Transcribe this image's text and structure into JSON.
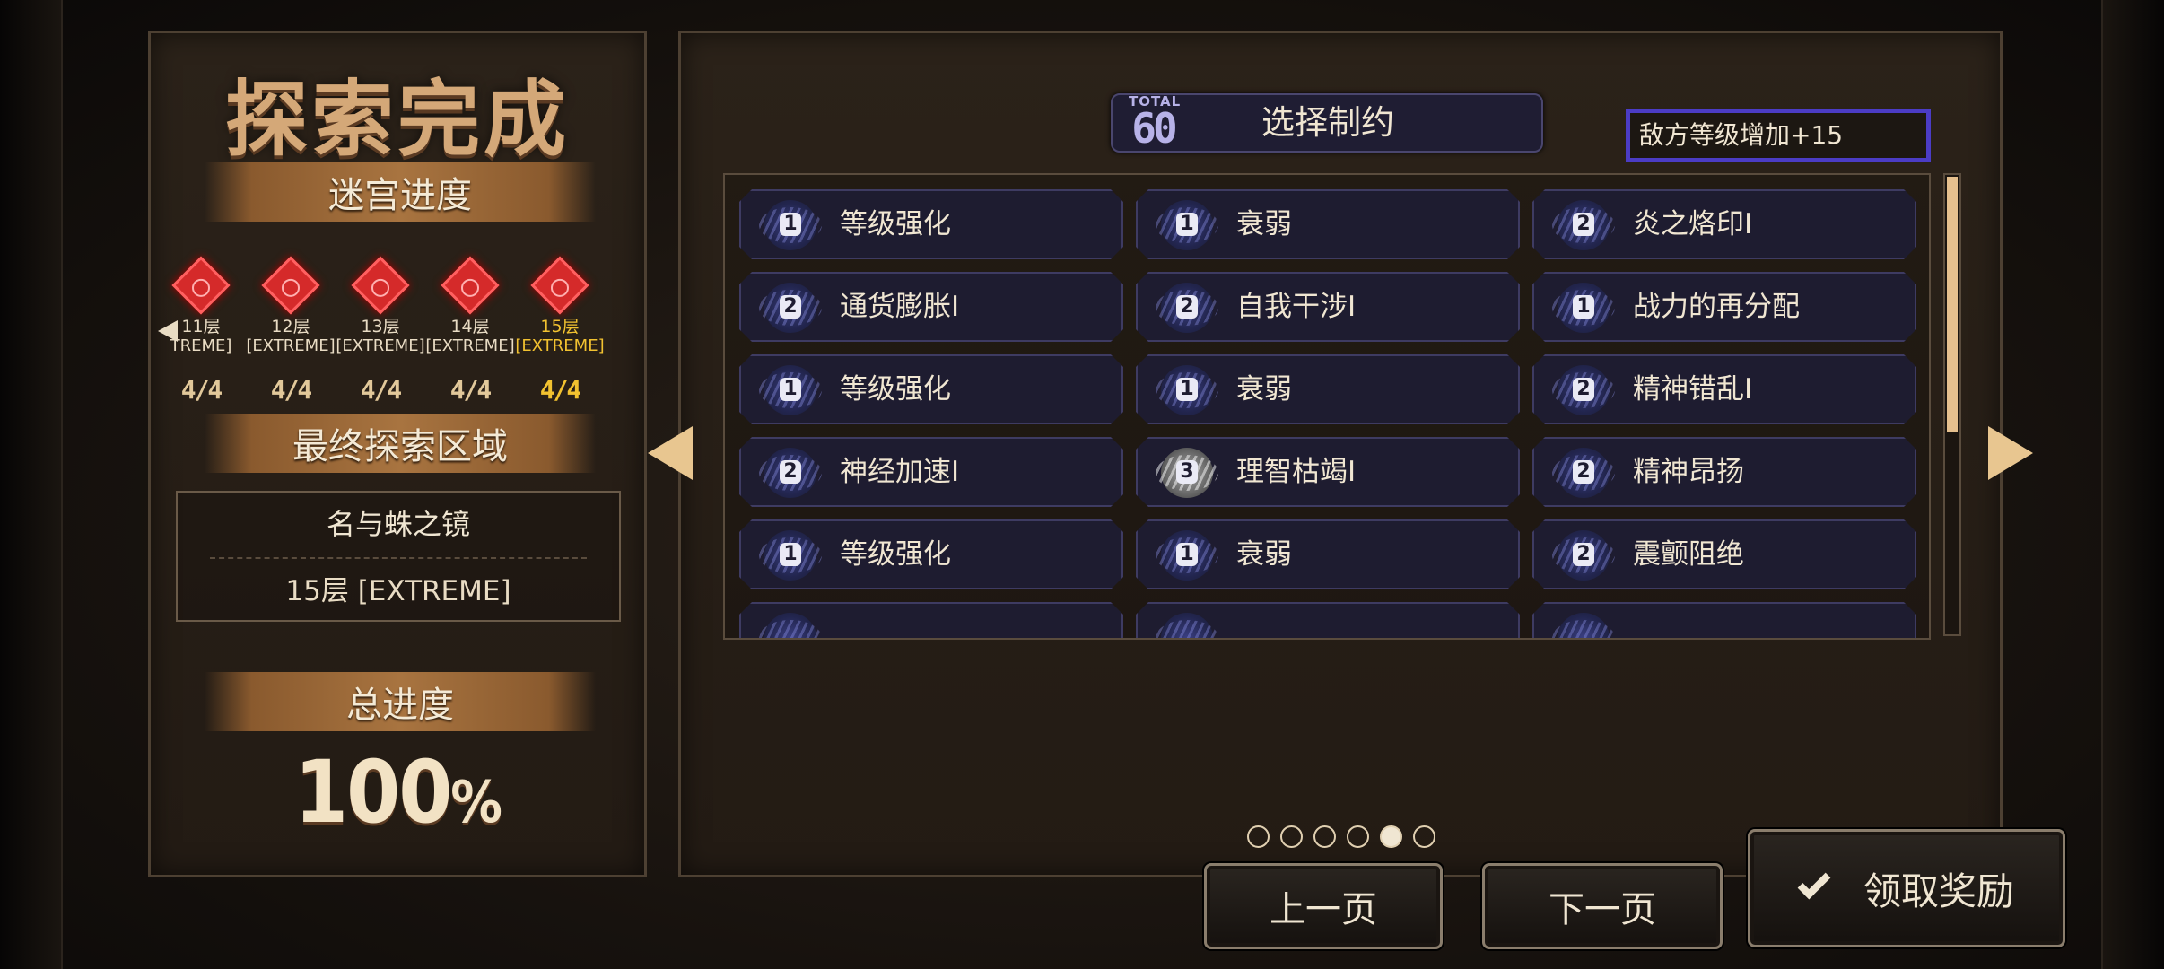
{
  "left_panel": {
    "title": "探索完成",
    "maze_progress_label": "迷宫进度",
    "floors": [
      {
        "label": "11层",
        "difficulty": "TREME]",
        "count": "4/4"
      },
      {
        "label": "12层",
        "difficulty": "[EXTREME]",
        "count": "4/4"
      },
      {
        "label": "13层",
        "difficulty": "[EXTREME]",
        "count": "4/4"
      },
      {
        "label": "14层",
        "difficulty": "[EXTREME]",
        "count": "4/4"
      },
      {
        "label": "15层",
        "difficulty": "[EXTREME]",
        "count": "4/4"
      }
    ],
    "final_area_label": "最终探索区域",
    "area_name": "名与蛛之镜",
    "area_floor": "15层 [EXTREME]",
    "total_progress_label": "总进度",
    "total_progress_value": "100",
    "total_progress_unit": "%"
  },
  "header": {
    "total_label": "TOTAL",
    "total_value": "60",
    "title": "选择制约"
  },
  "enemy_level_text": "敌方等级增加+15",
  "constraints": [
    [
      {
        "level": "1",
        "label": "等级强化"
      },
      {
        "level": "1",
        "label": "衰弱"
      },
      {
        "level": "2",
        "label": "炎之烙印I"
      }
    ],
    [
      {
        "level": "2",
        "label": "通货膨胀I"
      },
      {
        "level": "2",
        "label": "自我干涉I"
      },
      {
        "level": "1",
        "label": "战力的再分配"
      }
    ],
    [
      {
        "level": "1",
        "label": "等级强化"
      },
      {
        "level": "1",
        "label": "衰弱"
      },
      {
        "level": "2",
        "label": "精神错乱I"
      }
    ],
    [
      {
        "level": "2",
        "label": "神经加速I"
      },
      {
        "level": "3",
        "label": "理智枯竭I"
      },
      {
        "level": "2",
        "label": "精神昂扬"
      }
    ],
    [
      {
        "level": "1",
        "label": "等级强化"
      },
      {
        "level": "1",
        "label": "衰弱"
      },
      {
        "level": "2",
        "label": "震颤阻绝"
      }
    ]
  ],
  "pagination": {
    "total_pages": 6,
    "current_page": 5
  },
  "buttons": {
    "prev": "上一页",
    "next": "下一页",
    "claim": "领取奖励"
  }
}
